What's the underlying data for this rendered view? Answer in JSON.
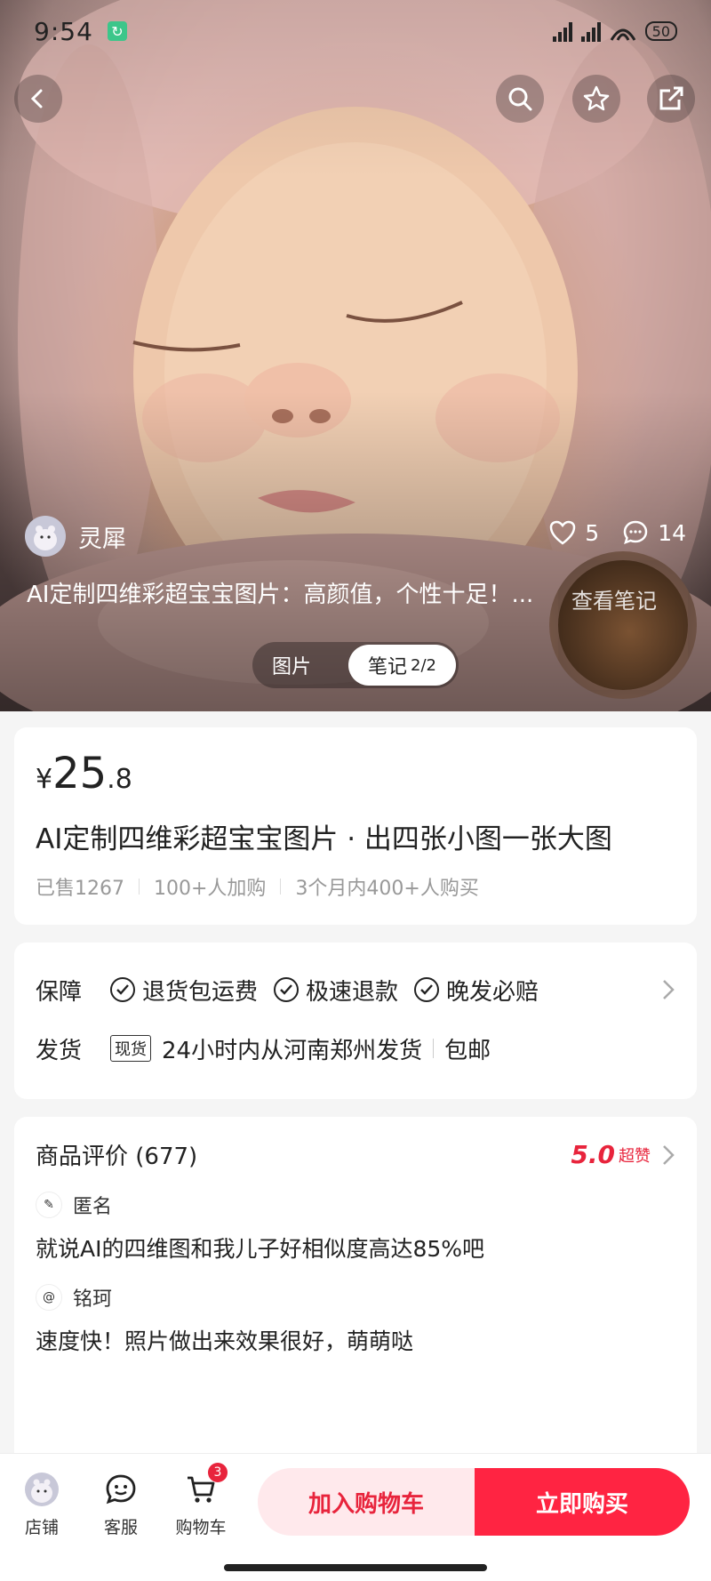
{
  "status_bar": {
    "time": "9:54",
    "battery": "50"
  },
  "hero": {
    "author_name": "灵犀",
    "likes": "5",
    "comments": "14",
    "note_title": "AI定制四维彩超宝宝图片：高颜值，个性十足！...",
    "view_note_label": "查看笔记",
    "tabs": [
      {
        "label": "图片"
      },
      {
        "label": "笔记",
        "count": "2/2"
      }
    ]
  },
  "product": {
    "currency": "¥",
    "price_int": "25",
    "price_dec": ".8",
    "title": "AI定制四维彩超宝宝图片 · 出四张小图一张大图",
    "sales": [
      "已售1267",
      "100+人加购",
      "3个月内400+人购买"
    ]
  },
  "guarantee": {
    "label": "保障",
    "items": [
      "退货包运费",
      "极速退款",
      "晚发必赔"
    ]
  },
  "shipping": {
    "label": "发货",
    "tag": "现货",
    "text": "24小时内从河南郑州发货",
    "extra": "包邮"
  },
  "reviews": {
    "title": "商品评价 (677)",
    "score": "5.0",
    "score_label": "超赞",
    "items": [
      {
        "user": "匿名",
        "text": "就说AI的四维图和我儿子好相似度高达85%吧"
      },
      {
        "user": "铭珂",
        "text": "速度快！照片做出来效果很好，萌萌哒"
      }
    ]
  },
  "bottom_bar": {
    "store": "店铺",
    "service": "客服",
    "cart": "购物车",
    "cart_count": "3",
    "add_to_cart": "加入购物车",
    "buy_now": "立即购买"
  },
  "colors": {
    "accent": "#ff2442",
    "price_red": "#e8243c",
    "cart_button_bg": "#ffe9ec"
  }
}
